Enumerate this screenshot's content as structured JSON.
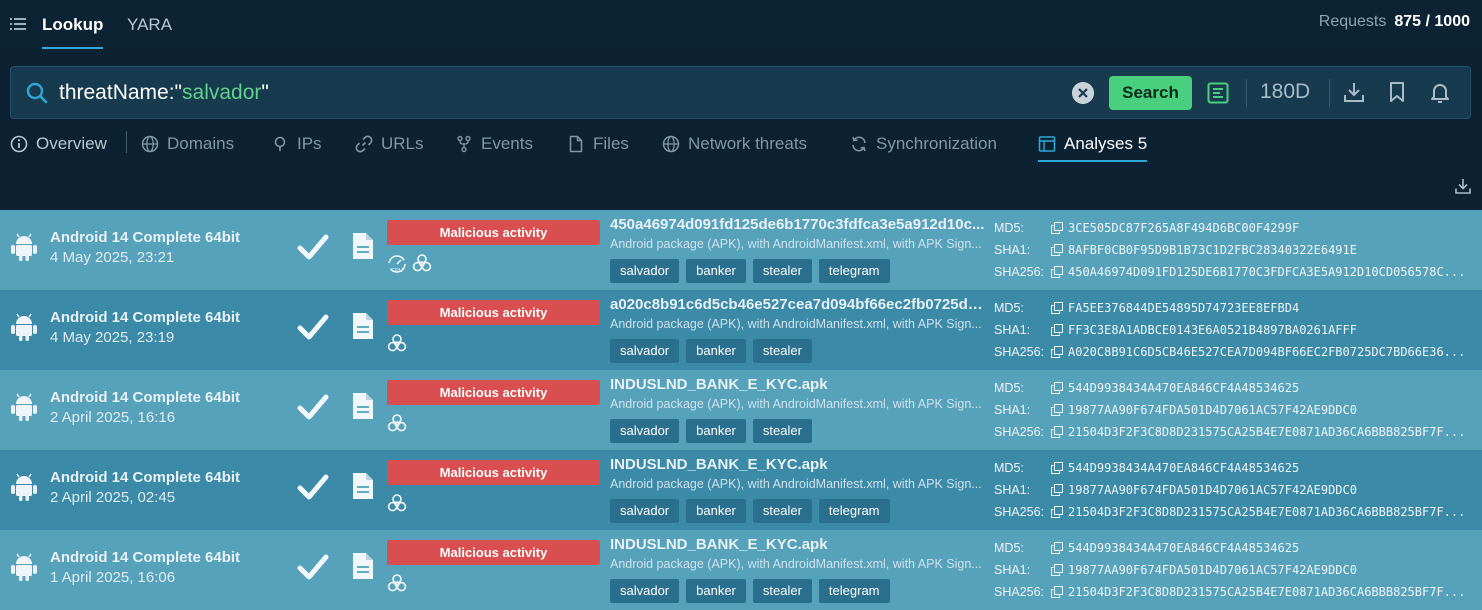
{
  "nav": {
    "tabs": [
      {
        "label": "Lookup",
        "active": true
      },
      {
        "label": "YARA",
        "active": false
      }
    ],
    "requests_label": "Requests",
    "requests_value": "875 / 1000"
  },
  "search": {
    "query_prefix": "threatName:\"",
    "query_value": "salvador",
    "query_suffix": "\"",
    "button_label": "Search",
    "period": "180D"
  },
  "subtabs": [
    {
      "label": "Overview",
      "icon": "info-icon"
    },
    {
      "label": "Domains",
      "icon": "globe-icon"
    },
    {
      "label": "IPs",
      "icon": "pin-icon"
    },
    {
      "label": "URLs",
      "icon": "link-icon"
    },
    {
      "label": "Events",
      "icon": "fork-icon"
    },
    {
      "label": "Files",
      "icon": "file-icon"
    },
    {
      "label": "Network threats",
      "icon": "globe-icon"
    },
    {
      "label": "Synchronization",
      "icon": "sync-icon"
    },
    {
      "label": "Analyses 5",
      "icon": "browser-icon",
      "active": true
    }
  ],
  "colors": {
    "verdict": "#d94f4f",
    "row_light": "#57a2bb",
    "row_dark": "#3a8aa8",
    "search_button": "#49d07f",
    "accent": "#2fa8d6"
  },
  "analyses": [
    {
      "os": "Android 14 Complete 64bit",
      "date": "4 May 2025, 23:21",
      "verdict": "Malicious activity",
      "icons": [
        "cpu-icon",
        "biohazard-icon"
      ],
      "name": "450a46974d091fd125de6b1770c3fdfca3e5a912d10c...",
      "type": "Android package (APK), with AndroidManifest.xml, with APK Sign...",
      "tags": [
        "salvador",
        "banker",
        "stealer",
        "telegram"
      ],
      "md5_label": "MD5:",
      "md5": "3CE505DC87F265A8F494D6BC00F4299F",
      "sha1_label": "SHA1:",
      "sha1": "8AFBF0CB0F95D9B1B73C1D2FBC28340322E6491E",
      "sha256_label": "SHA256:",
      "sha256": "450A46974D091FD125DE6B1770C3FDFCA3E5A912D10CD056578C..."
    },
    {
      "os": "Android 14 Complete 64bit",
      "date": "4 May 2025, 23:19",
      "verdict": "Malicious activity",
      "icons": [
        "biohazard-icon"
      ],
      "name": "a020c8b91c6d5cb46e527cea7d094bf66ec2fb0725dc...",
      "type": "Android package (APK), with AndroidManifest.xml, with APK Sign...",
      "tags": [
        "salvador",
        "banker",
        "stealer"
      ],
      "md5_label": "MD5:",
      "md5": "FA5EE376844DE54895D74723EE8EFBD4",
      "sha1_label": "SHA1:",
      "sha1": "FF3C3E8A1ADBCE0143E6A0521B4897BA0261AFFF",
      "sha256_label": "SHA256:",
      "sha256": "A020C8B91C6D5CB46E527CEA7D094BF66EC2FB0725DC7BD66E36..."
    },
    {
      "os": "Android 14 Complete 64bit",
      "date": "2 April 2025, 16:16",
      "verdict": "Malicious activity",
      "icons": [
        "biohazard-icon"
      ],
      "name": "INDUSLND_BANK_E_KYC.apk",
      "type": "Android package (APK), with AndroidManifest.xml, with APK Sign...",
      "tags": [
        "salvador",
        "banker",
        "stealer"
      ],
      "md5_label": "MD5:",
      "md5": "544D9938434A470EA846CF4A48534625",
      "sha1_label": "SHA1:",
      "sha1": "19877AA90F674FDA501D4D7061AC57F42AE9DDC0",
      "sha256_label": "SHA256:",
      "sha256": "21504D3F2F3C8D8D231575CA25B4E7E0871AD36CA6BBB825BF7F..."
    },
    {
      "os": "Android 14 Complete 64bit",
      "date": "2 April 2025, 02:45",
      "verdict": "Malicious activity",
      "icons": [
        "biohazard-icon"
      ],
      "name": "INDUSLND_BANK_E_KYC.apk",
      "type": "Android package (APK), with AndroidManifest.xml, with APK Sign...",
      "tags": [
        "salvador",
        "banker",
        "stealer",
        "telegram"
      ],
      "md5_label": "MD5:",
      "md5": "544D9938434A470EA846CF4A48534625",
      "sha1_label": "SHA1:",
      "sha1": "19877AA90F674FDA501D4D7061AC57F42AE9DDC0",
      "sha256_label": "SHA256:",
      "sha256": "21504D3F2F3C8D8D231575CA25B4E7E0871AD36CA6BBB825BF7F..."
    },
    {
      "os": "Android 14 Complete 64bit",
      "date": "1 April 2025, 16:06",
      "verdict": "Malicious activity",
      "icons": [
        "biohazard-icon"
      ],
      "name": "INDUSLND_BANK_E_KYC.apk",
      "type": "Android package (APK), with AndroidManifest.xml, with APK Sign...",
      "tags": [
        "salvador",
        "banker",
        "stealer",
        "telegram"
      ],
      "md5_label": "MD5:",
      "md5": "544D9938434A470EA846CF4A48534625",
      "sha1_label": "SHA1:",
      "sha1": "19877AA90F674FDA501D4D7061AC57F42AE9DDC0",
      "sha256_label": "SHA256:",
      "sha256": "21504D3F2F3C8D8D231575CA25B4E7E0871AD36CA6BBB825BF7F..."
    }
  ]
}
